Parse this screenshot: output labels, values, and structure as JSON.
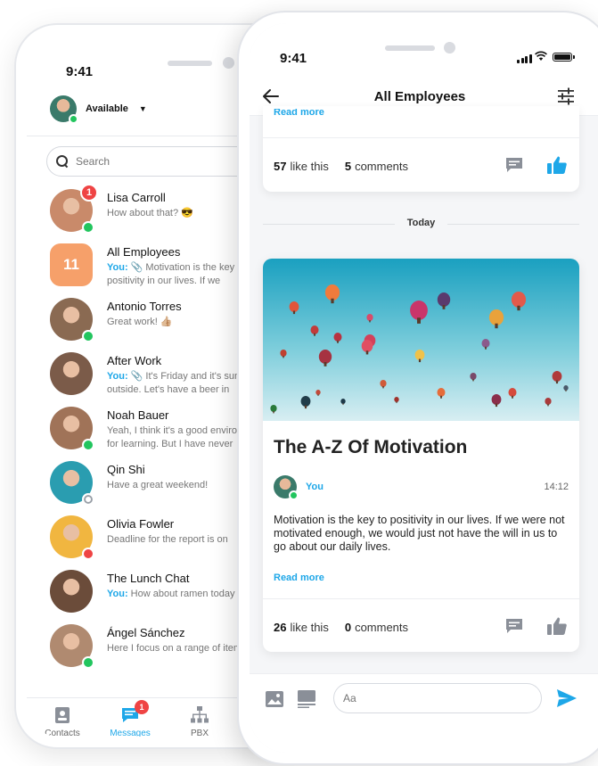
{
  "back_phone": {
    "status_time": "9:41",
    "availability": "Available",
    "search_placeholder": "Search",
    "conversations": [
      {
        "name": "Lisa Carroll",
        "you": "",
        "preview": "How about that? 😎",
        "badge": "1",
        "status": "online",
        "avatar_color": "#c98a6a"
      },
      {
        "name": "All Employees",
        "you": "You:",
        "preview": " 📎 Motivation is the key to positivity in our lives. If we",
        "badge": "",
        "status": "",
        "avatar_color": "#f6a06a",
        "group_count": "11"
      },
      {
        "name": "Antonio Torres",
        "you": "",
        "preview": "Great work! 👍🏼",
        "badge": "",
        "status": "online",
        "avatar_color": "#8a6a52"
      },
      {
        "name": "After Work",
        "you": "You:",
        "preview": " 📎 It's Friday and it's sunny outside. Let's have a beer in",
        "badge": "",
        "status": "",
        "avatar_color": "#7b5b49"
      },
      {
        "name": "Noah Bauer",
        "you": "",
        "preview": "Yeah, I think it's a good environment for learning. But I have never",
        "badge": "",
        "status": "online",
        "avatar_color": "#a07358"
      },
      {
        "name": "Qin Shi",
        "you": "",
        "preview": "Have a great weekend!",
        "badge": "",
        "status": "offline",
        "avatar_color": "#2a9db0"
      },
      {
        "name": "Olivia Fowler",
        "you": "",
        "preview": "Deadline for the report is on",
        "badge": "",
        "status": "busy",
        "avatar_color": "#f1b640"
      },
      {
        "name": "The Lunch Chat",
        "you": "You:",
        "preview": " How about ramen today",
        "badge": "",
        "status": "",
        "avatar_color": "#6b4c3a"
      },
      {
        "name": "Ángel Sánchez",
        "you": "",
        "preview": "Here I focus on a range of items",
        "badge": "",
        "status": "online",
        "avatar_color": "#b08a70"
      }
    ],
    "tabs": [
      {
        "label": "Contacts",
        "active": false
      },
      {
        "label": "Messages",
        "active": true,
        "badge": "1"
      },
      {
        "label": "PBX",
        "active": false
      }
    ]
  },
  "front_phone": {
    "status_time": "9:41",
    "header_title": "All Employees",
    "top_card": {
      "read_more": "Read more",
      "likes_count": "57",
      "likes_label": "like this",
      "comments_count": "5",
      "comments_label": "comments",
      "liked": true
    },
    "day_separator": "Today",
    "post": {
      "title": "The A-Z Of Motivation",
      "author": "You",
      "time": "14:12",
      "body": "Motivation is the key to positivity in our lives. If we were not motivated enough, we would just not have the will in us to go about our daily lives.",
      "read_more": "Read more",
      "likes_count": "26",
      "likes_label": "like this",
      "comments_count": "0",
      "comments_label": "comments",
      "liked": false
    },
    "composer_placeholder": "Aa"
  },
  "colors": {
    "accent": "#1ea7e8",
    "online": "#22c55e",
    "busy": "#ef4444",
    "badge": "#ef4444",
    "group_avatar": "#f6a06a",
    "sky_top": "#1aa0c0",
    "sky_bottom": "#d8eef2"
  }
}
